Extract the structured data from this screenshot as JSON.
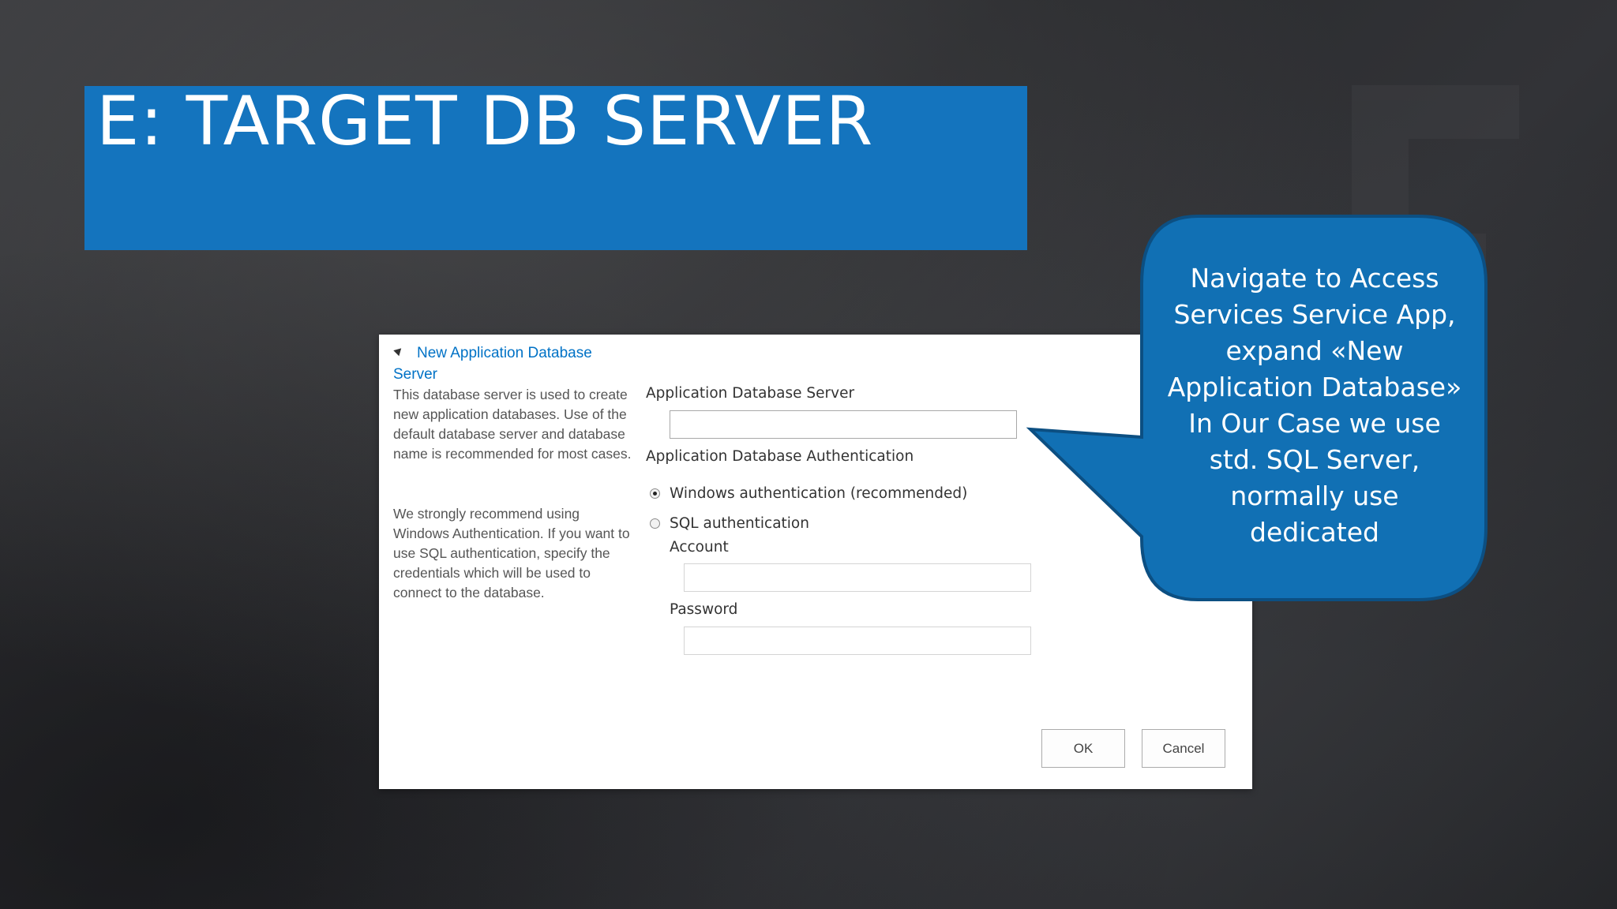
{
  "slide": {
    "title": "E: TARGET DB SERVER"
  },
  "dialog": {
    "section_title": "New Application Database Server",
    "description_1": "This database server is used to create new application databases. Use of the default database server and database name is recommended for most cases.",
    "description_2": "We strongly recommend using Windows Authentication. If you want to use SQL authentication, specify the credentials which will be used to connect to the database.",
    "server_label": "Application Database Server",
    "server_value": "",
    "auth_label": "Application Database Authentication",
    "auth_options": [
      {
        "label": "Windows authentication (recommended)",
        "selected": true
      },
      {
        "label": "SQL authentication",
        "selected": false
      }
    ],
    "account_label": "Account",
    "account_value": "",
    "password_label": "Password",
    "password_value": "",
    "ok_label": "OK",
    "cancel_label": "Cancel"
  },
  "callout": {
    "lines": [
      "Navigate to Access",
      "Services Service App,",
      "expand «New",
      "Application Database»",
      "In Our Case we use",
      "std. SQL Server,",
      "normally use",
      "dedicated"
    ],
    "fill_color": "#1170b4",
    "border_color": "#0c4f82"
  },
  "colors": {
    "title_band": "#1474be",
    "link": "#0072c6"
  }
}
